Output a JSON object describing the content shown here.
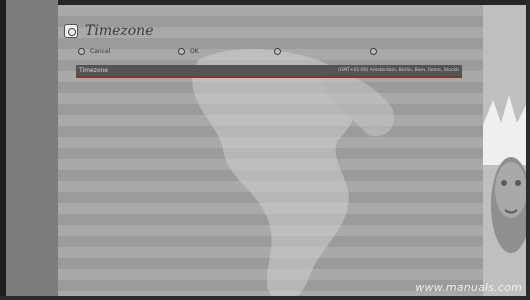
{
  "dialog": {
    "title": "Timezone",
    "icon": "globe-settings-icon"
  },
  "buttons": [
    {
      "label": "Cancel",
      "icon": "circle-button-icon"
    },
    {
      "label": "OK",
      "icon": "circle-button-icon"
    },
    {
      "label": "",
      "icon": "circle-button-icon"
    },
    {
      "label": "",
      "icon": "circle-button-icon"
    }
  ],
  "selected_row": {
    "key": "Timezone",
    "value": "(GMT+01:00) Amsterdam, Berlin, Bern, Rome, Stockh"
  },
  "watermark": "www.manuals.com",
  "colors": {
    "row_highlight": "#545454",
    "row_underline": "#7d3a2b",
    "stripe_light": "#a9a9a9",
    "stripe_dark": "#9b9b9b"
  }
}
